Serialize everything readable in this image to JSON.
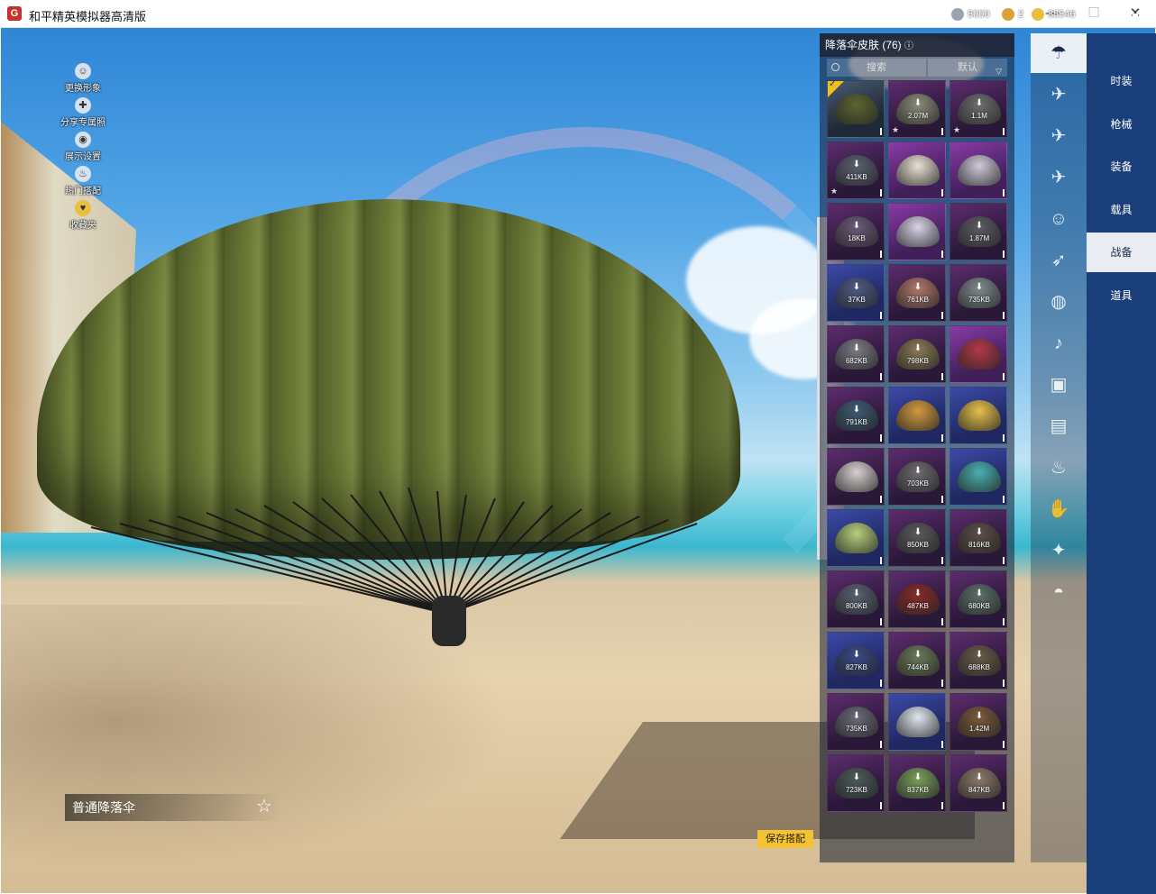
{
  "window": {
    "title": "和平精英模拟器高清版",
    "minimize": "—",
    "maximize": "☐",
    "close": "✕"
  },
  "side_menu": [
    {
      "label": "更换形象",
      "icon": "person-icon"
    },
    {
      "label": "分享专属照",
      "icon": "share-icon"
    },
    {
      "label": "展示设置",
      "icon": "eye-icon"
    },
    {
      "label": "热门搭配",
      "icon": "fire-icon"
    },
    {
      "label": "收藏夹",
      "icon": "favorite-icon"
    }
  ],
  "currencies": [
    {
      "value": "5000",
      "color": "#9aa3b4"
    },
    {
      "value": "2",
      "color": "#d8a43a"
    },
    {
      "value": "85546",
      "color": "#e8c040"
    }
  ],
  "panel": {
    "title": "降落伞皮肤 (76)",
    "search_label": "搜索",
    "sort_label": "默认"
  },
  "tiles": [
    {
      "size": "",
      "style": "selected",
      "color": "#5b6532",
      "selected": true
    },
    {
      "size": "2.07M",
      "style": "",
      "color": "#8b8b7a",
      "star": true
    },
    {
      "size": "1.1M",
      "style": "",
      "color": "#6d6e70",
      "star": true
    },
    {
      "size": "411KB",
      "style": "",
      "color": "#5a6070",
      "star": true
    },
    {
      "size": "",
      "style": "purple",
      "color": "#e9e2d4"
    },
    {
      "size": "",
      "style": "purple",
      "color": "#cfc9d9"
    },
    {
      "size": "18KB",
      "style": "",
      "color": "#6b5a7a"
    },
    {
      "size": "",
      "style": "purple",
      "color": "#d8d3e8"
    },
    {
      "size": "1.87M",
      "style": "",
      "color": "#5d5b64"
    },
    {
      "size": "37KB",
      "style": "blue",
      "color": "#4e5a86"
    },
    {
      "size": "761KB",
      "style": "",
      "color": "#b0786a"
    },
    {
      "size": "735KB",
      "style": "",
      "color": "#7f8a8c"
    },
    {
      "size": "682KB",
      "style": "",
      "color": "#7b7a82"
    },
    {
      "size": "798KB",
      "style": "",
      "color": "#8a7a54"
    },
    {
      "size": "",
      "style": "purple",
      "color": "#b23a4a"
    },
    {
      "size": "791KB",
      "style": "",
      "color": "#3e5a74"
    },
    {
      "size": "",
      "style": "blue",
      "color": "#d29a40"
    },
    {
      "size": "",
      "style": "blue",
      "color": "#e6c04a"
    },
    {
      "size": "",
      "style": "",
      "color": "#d8d0d0"
    },
    {
      "size": "703KB",
      "style": "",
      "color": "#6e6a70"
    },
    {
      "size": "",
      "style": "blue",
      "color": "#4ab0b0"
    },
    {
      "size": "",
      "style": "blue",
      "color": "#b6d07a"
    },
    {
      "size": "850KB",
      "style": "",
      "color": "#5a5a5e"
    },
    {
      "size": "816KB",
      "style": "",
      "color": "#5c4e48"
    },
    {
      "size": "800KB",
      "style": "",
      "color": "#5a6070"
    },
    {
      "size": "487KB",
      "style": "",
      "color": "#8a2a2a"
    },
    {
      "size": "680KB",
      "style": "",
      "color": "#5a7068"
    },
    {
      "size": "827KB",
      "style": "blue",
      "color": "#3a4a8a"
    },
    {
      "size": "744KB",
      "style": "",
      "color": "#6b7a5a"
    },
    {
      "size": "688KB",
      "style": "",
      "color": "#6a5a4a"
    },
    {
      "size": "735KB",
      "style": "",
      "color": "#6a6a78"
    },
    {
      "size": "",
      "style": "blue",
      "color": "#e0e6f0"
    },
    {
      "size": "1.42M",
      "style": "",
      "color": "#7a5a3a"
    },
    {
      "size": "723KB",
      "style": "",
      "color": "#4e5a5a"
    },
    {
      "size": "837KB",
      "style": "",
      "color": "#7aa05a"
    },
    {
      "size": "847KB",
      "style": "",
      "color": "#8a7a6a"
    }
  ],
  "categories": [
    {
      "icon": "parachute-icon",
      "active": true
    },
    {
      "icon": "aircraft-trail-icon"
    },
    {
      "icon": "plane-icon"
    },
    {
      "icon": "jet-icon"
    },
    {
      "icon": "emote-icon"
    },
    {
      "icon": "glider-icon"
    },
    {
      "icon": "pet-icon"
    },
    {
      "icon": "speaker-icon"
    },
    {
      "icon": "badge-icon"
    },
    {
      "icon": "photo-icon"
    },
    {
      "icon": "extinguisher-icon"
    },
    {
      "icon": "hand-icon"
    },
    {
      "icon": "wand-icon"
    },
    {
      "icon": "ufo-icon"
    }
  ],
  "tabs": [
    {
      "label": "时装"
    },
    {
      "label": "枪械"
    },
    {
      "label": "装备"
    },
    {
      "label": "载具"
    },
    {
      "label": "战备",
      "active": true
    },
    {
      "label": "道具"
    }
  ],
  "preview_name": "普通降落伞",
  "save_button": "保存搭配"
}
